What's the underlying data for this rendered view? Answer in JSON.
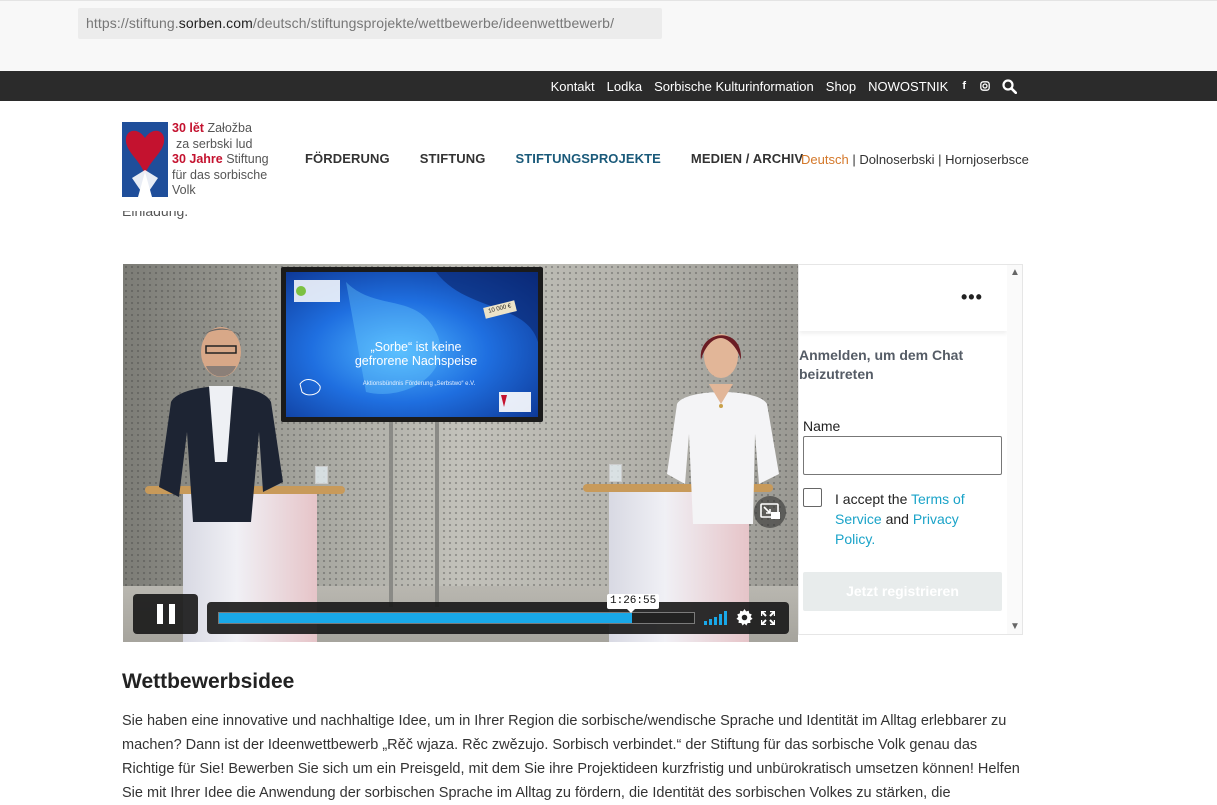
{
  "browser": {
    "url_prefix": "https://stiftung.",
    "url_host": "sorben.com",
    "url_path": "/deutsch/stiftungsprojekte/wettbewerbe/ideenwettbewerb/"
  },
  "topbar": {
    "links": [
      "Kontakt",
      "Lodka",
      "Sorbische Kulturinformation",
      "Shop",
      "NOWOSTNIK"
    ],
    "facebook_glyph": "f",
    "icons": [
      "facebook-icon",
      "instagram-icon",
      "search-icon"
    ]
  },
  "logo": {
    "line1_red": "30 lět",
    "line1_rest": "Załožba",
    "line2": "za serbski lud",
    "line3_red": "30 Jahre",
    "line3_rest": "Stiftung",
    "line4": "für das sorbische",
    "line5": "Volk"
  },
  "mainnav": [
    "FÖRDERUNG",
    "STIFTUNG",
    "STIFTUNGSPROJEKTE",
    "MEDIEN / ARCHIV"
  ],
  "mainnav_active": "STIFTUNGSPROJEKTE",
  "langs": {
    "current": "Deutsch",
    "sep": " | ",
    "lower": "Dolnoserbski",
    "upper": "Hornjoserbsce"
  },
  "intro_fragment": "Einladung.",
  "video": {
    "screen_title": "„Sorbe“ ist keine gefrorene Nachspeise",
    "screen_sub": "Aktionsbündnis Förderung „Serbstwo“ e.V.",
    "screen_badge": "10 000 €",
    "timecode": "1:26:55",
    "progress": 0.87,
    "accent_color": "#19a8e8"
  },
  "chat": {
    "more_label": "•••",
    "prompt": "Anmelden, um dem Chat beizutreten",
    "name_label": "Name",
    "name_value": "",
    "terms_prefix": "I accept the ",
    "terms_link": "Terms of Service",
    "terms_and": " and ",
    "privacy_link": "Privacy Policy",
    "terms_end": ".",
    "register_button": "Jetzt registrieren",
    "scroll_up": "▲",
    "scroll_down": "▼"
  },
  "content": {
    "heading": "Wettbewerbsidee",
    "paragraph": "Sie haben eine innovative und nachhaltige Idee, um in Ihrer Region die sorbische/wendische Sprache und Identität im Alltag erlebbarer zu machen? Dann ist der Ideenwettbewerb „Rěč wjaza. Rěc zwězujo. Sorbisch verbindet.“ der Stiftung für das sorbische Volk genau das Richtige für Sie! Bewerben Sie sich um ein Preisgeld, mit dem Sie ihre Projektideen kurzfristig und unbürokratisch umsetzen können! Helfen Sie mit Ihrer Idee die Anwendung der sorbischen Sprache im Alltag zu fördern, die Identität des sorbischen Volkes zu stärken, die"
  }
}
